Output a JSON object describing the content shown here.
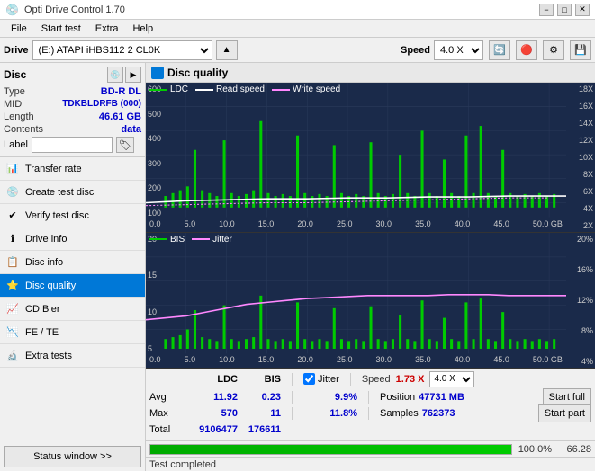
{
  "titlebar": {
    "title": "Opti Drive Control 1.70",
    "minimize": "−",
    "maximize": "□",
    "close": "✕"
  },
  "menubar": {
    "items": [
      "File",
      "Start test",
      "Extra",
      "Help"
    ]
  },
  "drivebar": {
    "label": "Drive",
    "drive_value": "(E:) ATAPI iHBS112  2 CL0K",
    "speed_label": "Speed",
    "speed_value": "4.0 X"
  },
  "sidebar": {
    "disc_title": "Disc",
    "type_label": "Type",
    "type_value": "BD-R DL",
    "mid_label": "MID",
    "mid_value": "TDKBLDRFB (000)",
    "length_label": "Length",
    "length_value": "46.61 GB",
    "contents_label": "Contents",
    "contents_value": "data",
    "label_label": "Label",
    "label_value": "",
    "items": [
      {
        "id": "transfer-rate",
        "label": "Transfer rate",
        "icon": "📊"
      },
      {
        "id": "create-test-disc",
        "label": "Create test disc",
        "icon": "💿"
      },
      {
        "id": "verify-test-disc",
        "label": "Verify test disc",
        "icon": "✔"
      },
      {
        "id": "drive-info",
        "label": "Drive info",
        "icon": "ℹ"
      },
      {
        "id": "disc-info",
        "label": "Disc info",
        "icon": "📋"
      },
      {
        "id": "disc-quality",
        "label": "Disc quality",
        "icon": "⭐",
        "active": true
      },
      {
        "id": "cd-bler",
        "label": "CD Bler",
        "icon": "📈"
      },
      {
        "id": "fe-te",
        "label": "FE / TE",
        "icon": "📉"
      },
      {
        "id": "extra-tests",
        "label": "Extra tests",
        "icon": "🔬"
      }
    ],
    "status_btn": "Status window >>"
  },
  "chart": {
    "title": "Disc quality",
    "icon_color": "#0078d7",
    "top_legend": [
      {
        "label": "LDC",
        "color": "#00aa00"
      },
      {
        "label": "Read speed",
        "color": "#ffffff"
      },
      {
        "label": "Write speed",
        "color": "#ff00ff"
      }
    ],
    "top_y_labels": [
      "18X",
      "16X",
      "14X",
      "12X",
      "10X",
      "8X",
      "6X",
      "4X",
      "2X"
    ],
    "top_y_left": [
      "600",
      "500",
      "400",
      "300",
      "200",
      "100"
    ],
    "x_labels": [
      "0.0",
      "5.0",
      "10.0",
      "15.0",
      "20.0",
      "25.0",
      "30.0",
      "35.0",
      "40.0",
      "45.0",
      "50.0 GB"
    ],
    "bottom_legend": [
      {
        "label": "BIS",
        "color": "#00aa00"
      },
      {
        "label": "Jitter",
        "color": "#ff88ff"
      }
    ],
    "bottom_y_right": [
      "20%",
      "16%",
      "12%",
      "8%",
      "4%"
    ],
    "bottom_y_left": [
      "20",
      "15",
      "10",
      "5"
    ]
  },
  "stats": {
    "headers": {
      "ldc": "LDC",
      "bis": "BIS",
      "jitter": "Jitter",
      "speed_label": "Speed",
      "speed_val": "1.73 X",
      "speed_select": "4.0 X"
    },
    "avg_label": "Avg",
    "avg_ldc": "11.92",
    "avg_bis": "0.23",
    "avg_jitter": "9.9%",
    "max_label": "Max",
    "max_ldc": "570",
    "max_bis": "11",
    "max_jitter": "11.8%",
    "position_label": "Position",
    "position_val": "47731 MB",
    "total_label": "Total",
    "total_ldc": "9106477",
    "total_bis": "176611",
    "samples_label": "Samples",
    "samples_val": "762373",
    "btn_start_full": "Start full",
    "btn_start_part": "Start part"
  },
  "progress": {
    "fill_pct": 100,
    "text": "100.0%",
    "time": "66.28"
  },
  "statusbar": {
    "text": "Test completed"
  }
}
